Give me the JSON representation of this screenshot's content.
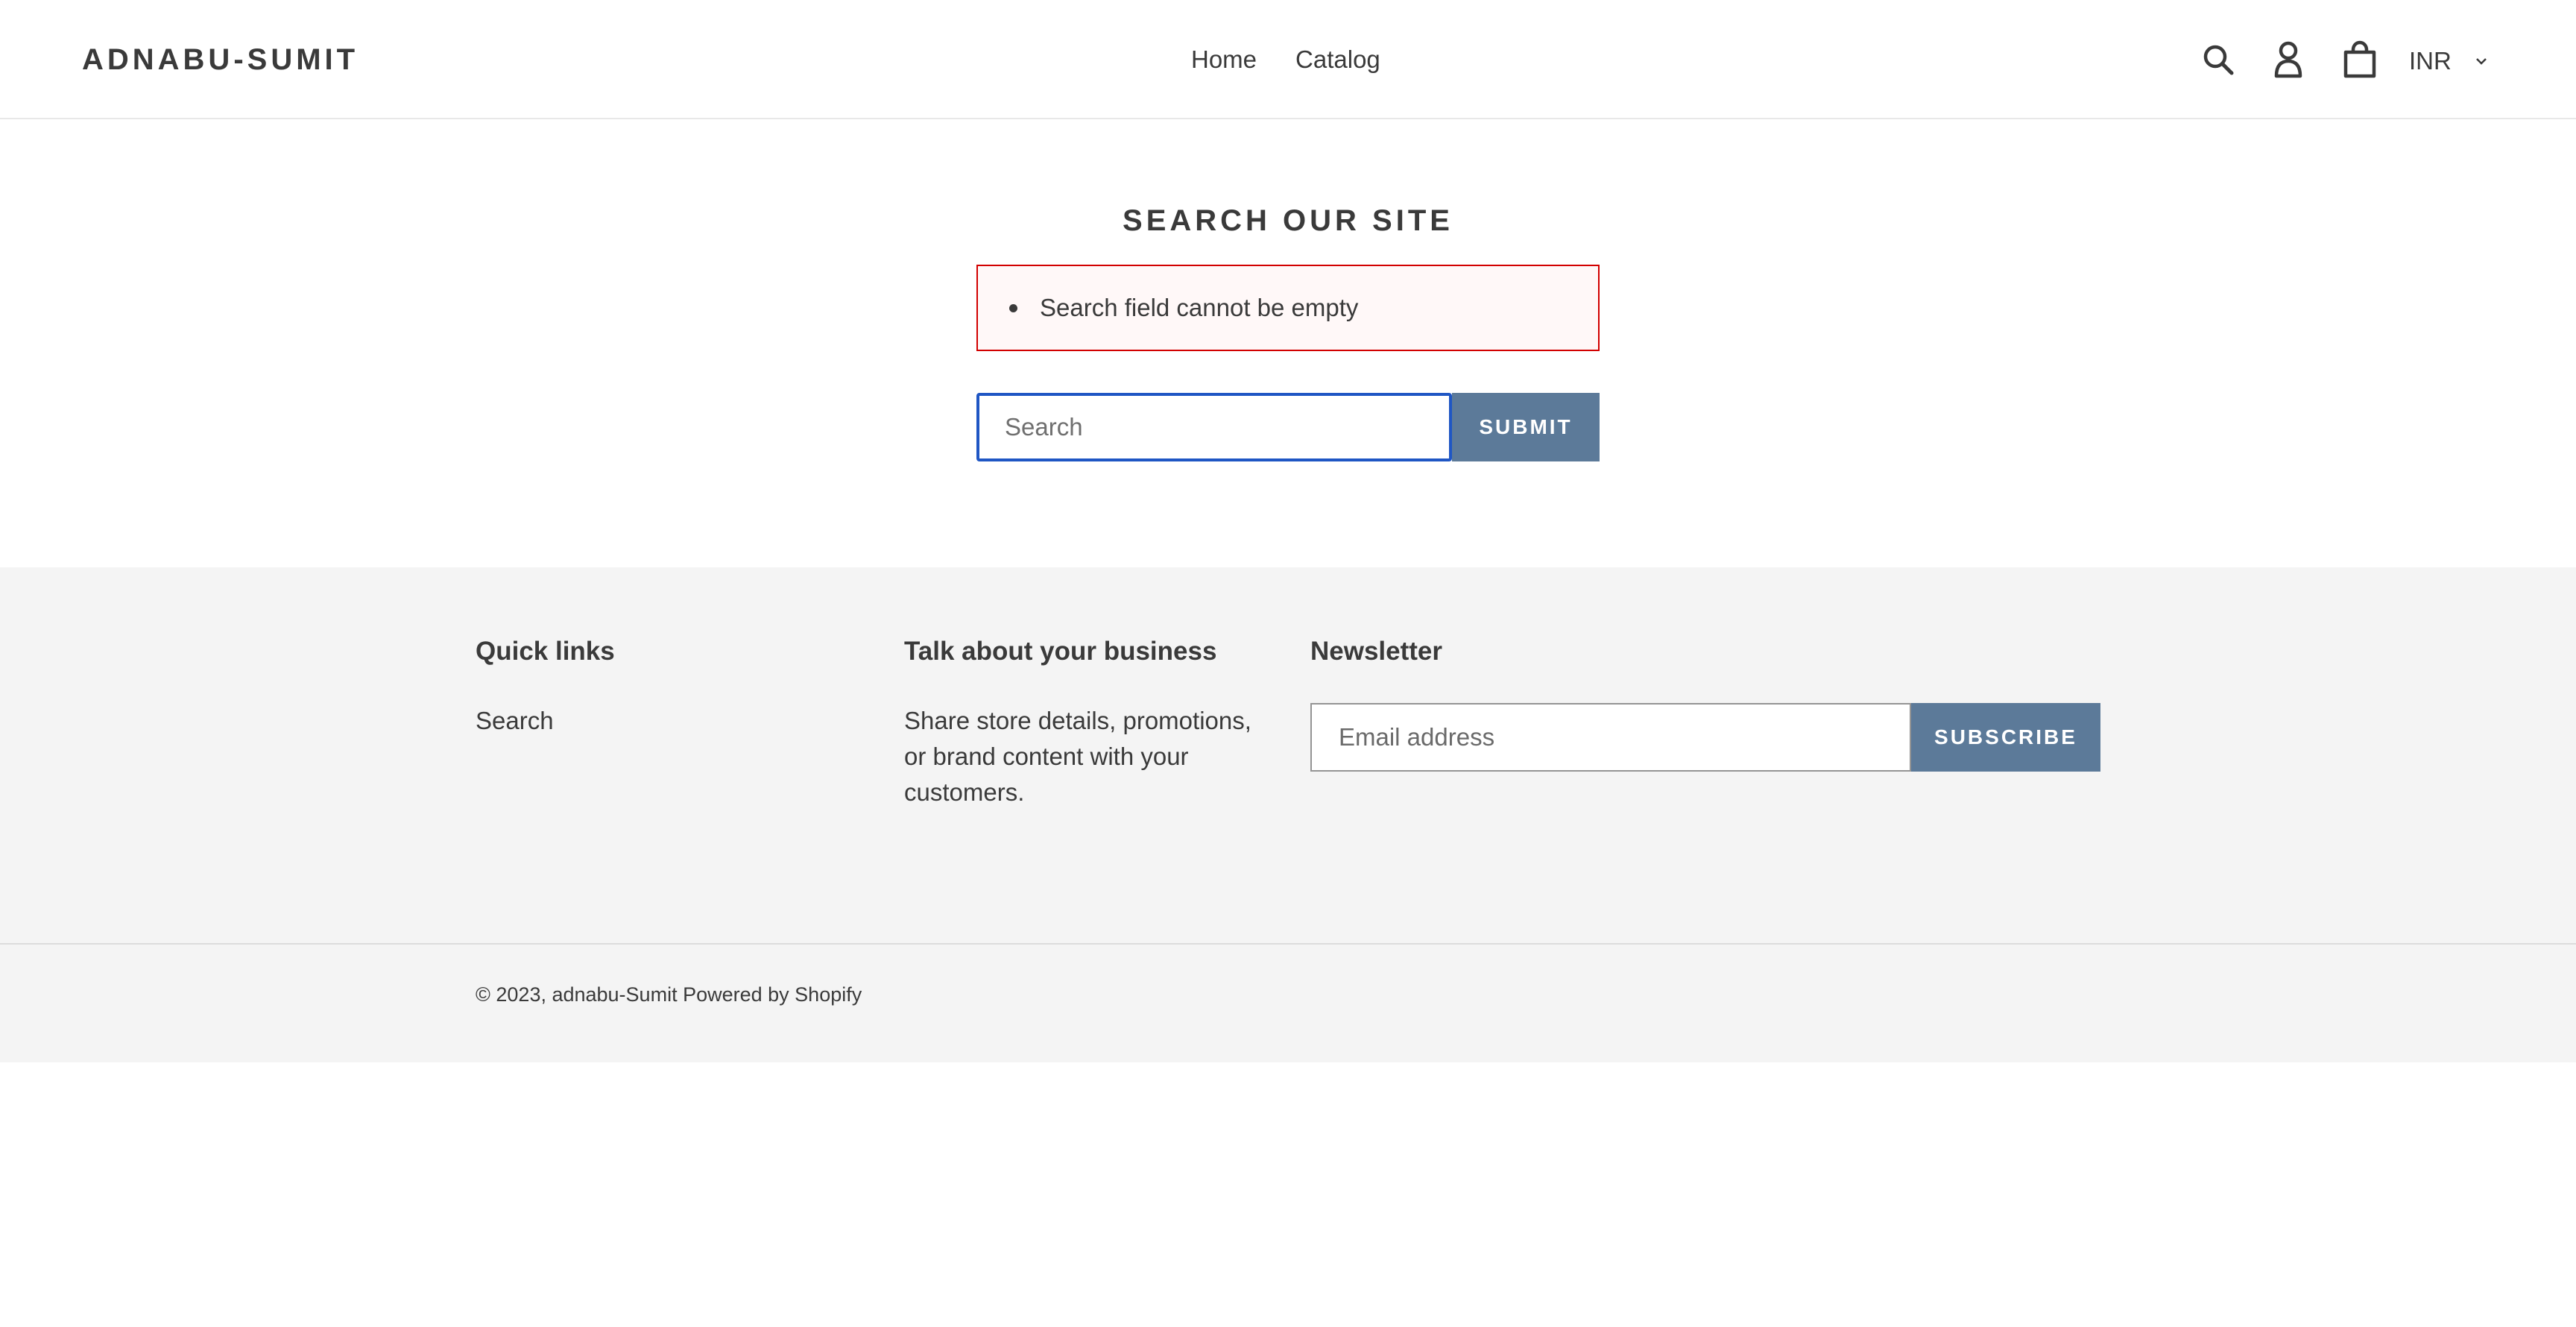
{
  "header": {
    "logo": "ADNABU-SUMIT",
    "nav": [
      {
        "label": "Home"
      },
      {
        "label": "Catalog"
      }
    ],
    "icons": {
      "search": "search-icon",
      "account": "account-icon",
      "cart": "cart-icon"
    },
    "currency": {
      "selected": "INR",
      "icon": "chevron-down-icon"
    }
  },
  "main": {
    "title": "SEARCH OUR SITE",
    "error": "Search field cannot be empty",
    "search": {
      "placeholder": "Search",
      "value": "",
      "submit_label": "SUBMIT"
    }
  },
  "footer": {
    "quick_links": {
      "heading": "Quick links",
      "links": [
        {
          "label": "Search"
        }
      ]
    },
    "business": {
      "heading": "Talk about your business",
      "text": "Share store details, promotions, or brand content with your customers."
    },
    "newsletter": {
      "heading": "Newsletter",
      "placeholder": "Email address",
      "button_label": "SUBSCRIBE"
    },
    "copyright": "© 2023, adnabu-Sumit",
    "powered_by": "Powered by Shopify"
  },
  "colors": {
    "accent": "#5c7a99",
    "error_border": "#d20000",
    "error_bg": "#fff8f8",
    "focus_border": "#1f56c4",
    "footer_bg": "#f4f4f4",
    "text": "#3a3a3a"
  }
}
